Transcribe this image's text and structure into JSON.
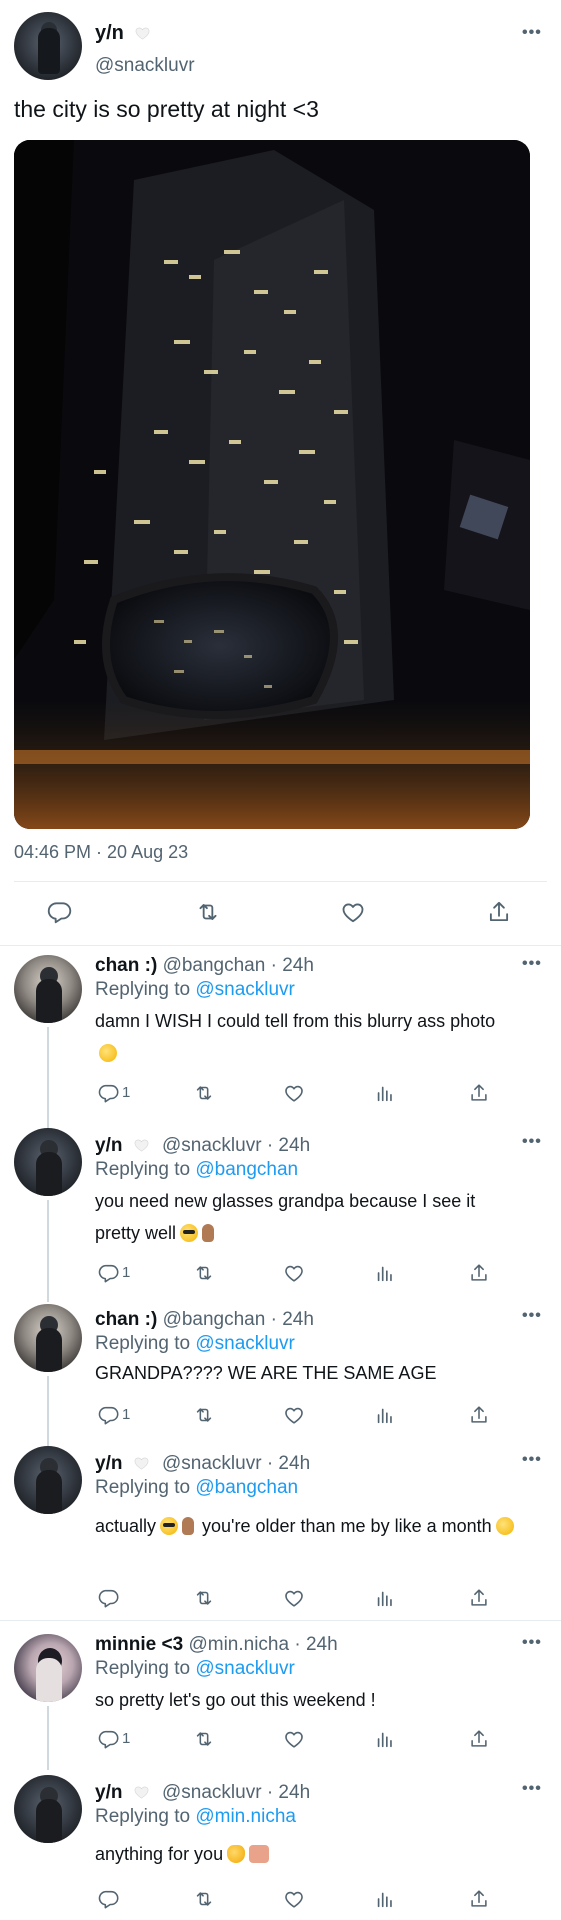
{
  "main_tweet": {
    "author_name": "y/n",
    "handle": "@snackluvr",
    "text": "the city is so pretty at night <3",
    "timestamp": "04:46 PM · 20 Aug 23",
    "more_label": "•••"
  },
  "replies": [
    {
      "name": "chan :)",
      "meta": "@bangchan · 24h",
      "replying_prefix": "Replying to ",
      "replying_to": "@snackluvr",
      "text": "damn I WISH I could tell from this blurry ass photo",
      "reply_count": "1",
      "emoji": [
        "grin"
      ]
    },
    {
      "name": "y/n",
      "meta": "@snackluvr · 24h",
      "replying_prefix": "Replying to ",
      "replying_to": "@bangchan",
      "text": "you need new glasses grandpa because I see it pretty well",
      "reply_count": "1",
      "emoji": [
        "sunglasses-face",
        "hand"
      ]
    },
    {
      "name": "chan :)",
      "meta": "@bangchan · 24h",
      "replying_prefix": "Replying to ",
      "replying_to": "@snackluvr",
      "text": "GRANDPA???? WE ARE THE SAME AGE",
      "reply_count": "1"
    },
    {
      "name": "y/n",
      "meta": "@snackluvr · 24h",
      "replying_prefix": "Replying to ",
      "replying_to": "@bangchan",
      "text_part1": "actually",
      "text_part2": "you're older than me by like a month",
      "reply_count": "",
      "emoji": [
        "sunglasses-face",
        "hand",
        "grin"
      ]
    },
    {
      "name": "minnie <3",
      "meta": "@min.nicha · 24h",
      "replying_prefix": "Replying to ",
      "replying_to": "@snackluvr",
      "text": "so pretty let's go out this weekend !",
      "reply_count": "1"
    },
    {
      "name": "y/n",
      "meta": "@snackluvr · 24h",
      "replying_prefix": "Replying to ",
      "replying_to": "@min.nicha",
      "text": "anything for you",
      "reply_count": "",
      "emoji": [
        "cat-face",
        "heart-hands"
      ]
    }
  ],
  "icons": [
    "reply-icon",
    "retweet-icon",
    "like-icon",
    "analytics-icon",
    "share-icon",
    "white-heart-icon",
    "more-icon"
  ],
  "colors": {
    "link": "#1d9bf0",
    "secondary_text": "#536471",
    "divider": "#e6ecf0"
  }
}
